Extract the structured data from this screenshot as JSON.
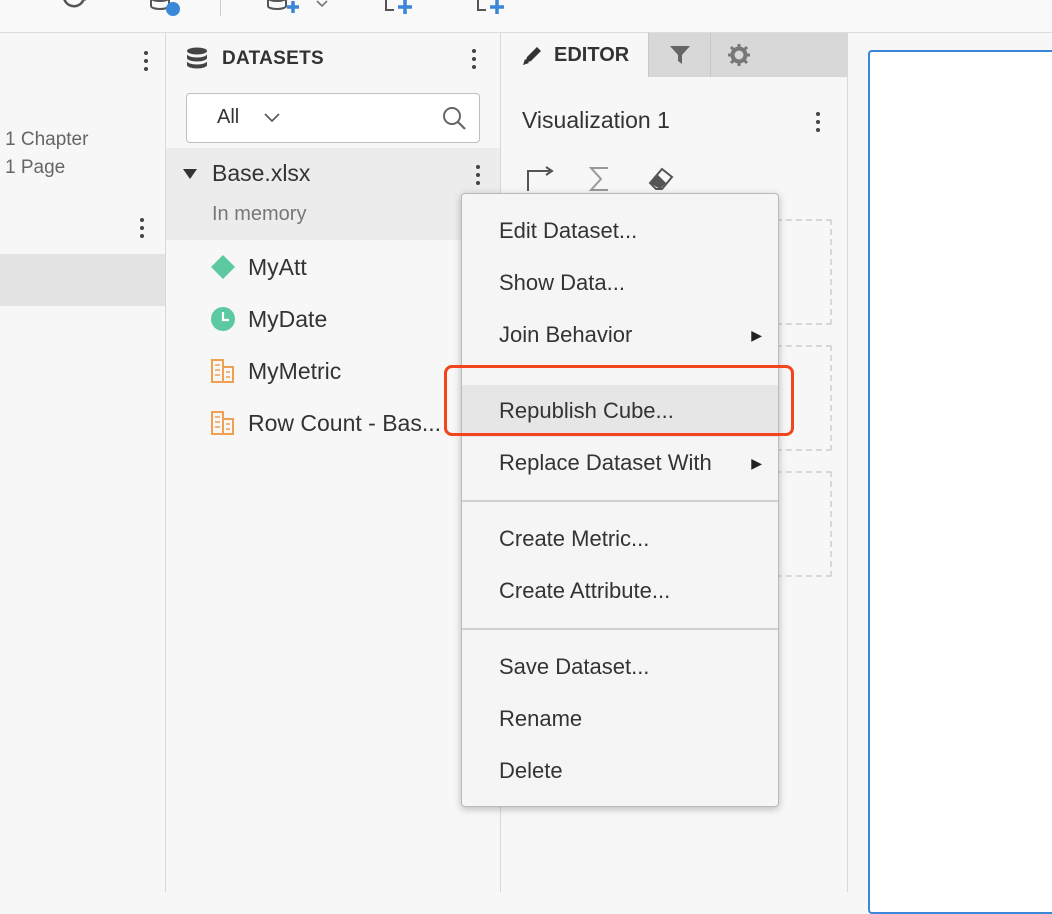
{
  "left_panel": {
    "chapter_count": "1 Chapter",
    "page_count": "1 Page"
  },
  "datasets": {
    "title": "DATASETS",
    "filter_value": "All",
    "dataset_name": "Base.xlsx",
    "dataset_status": "In memory",
    "objects": [
      {
        "name": "MyAtt",
        "icon": "attribute-icon"
      },
      {
        "name": "MyDate",
        "icon": "date-attribute-icon"
      },
      {
        "name": "MyMetric",
        "icon": "metric-icon"
      },
      {
        "name": "Row Count - Bas...",
        "icon": "metric-icon"
      }
    ]
  },
  "editor": {
    "tab_label": "EDITOR",
    "visualization_title": "Visualization 1"
  },
  "context_menu": {
    "items": [
      {
        "label": "Edit Dataset..."
      },
      {
        "label": "Show Data..."
      },
      {
        "label": "Join Behavior",
        "submenu": true
      },
      {
        "label": "Republish Cube...",
        "highlighted": true
      },
      {
        "label": "Replace Dataset With",
        "submenu": true
      },
      {
        "label": "Create Metric..."
      },
      {
        "label": "Create Attribute..."
      },
      {
        "label": "Save Dataset..."
      },
      {
        "label": "Rename"
      },
      {
        "label": "Delete"
      }
    ]
  },
  "colors": {
    "accent_blue": "#3a86d8",
    "highlight_red": "#f2451d",
    "attribute_green": "#5cc9a0",
    "metric_orange": "#f0a050"
  }
}
